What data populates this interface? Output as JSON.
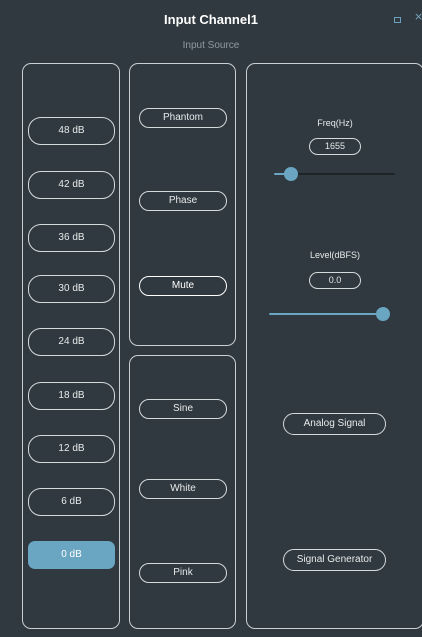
{
  "window": {
    "title": "Input Channel1",
    "subtitle": "Input Source",
    "minimize_icon": "minimize-icon",
    "close_icon": "close-icon",
    "close_glyph": "×"
  },
  "gain": {
    "options": [
      "48 dB",
      "42 dB",
      "36 dB",
      "30 dB",
      "24 dB",
      "18 dB",
      "12 dB",
      "6 dB",
      "0 dB"
    ],
    "selected": "0 dB"
  },
  "controls": {
    "phantom": "Phantom",
    "phase": "Phase",
    "mute": "Mute"
  },
  "generator": {
    "sine": "Sine",
    "white": "White",
    "pink": "Pink"
  },
  "freq": {
    "label": "Freq(Hz)",
    "value": "1655",
    "slider_fraction": 0.14
  },
  "level": {
    "label": "Level(dBFS)",
    "value": "0.0",
    "slider_fraction": 1.0
  },
  "source": {
    "analog": "Analog Signal",
    "generator": "Signal Generator"
  },
  "colors": {
    "background": "#30393f",
    "accent": "#6aa6c2",
    "border": "#c9cfd3"
  }
}
